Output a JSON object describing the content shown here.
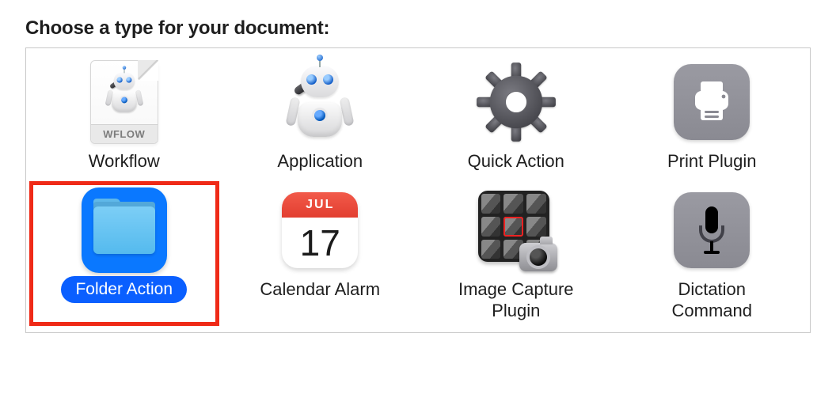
{
  "title": "Choose a type for your document:",
  "selected_type_id": "folder-action",
  "types": {
    "workflow": {
      "label": "Workflow",
      "file_tag": "WFLOW"
    },
    "application": {
      "label": "Application"
    },
    "quick_action": {
      "label": "Quick Action"
    },
    "print_plugin": {
      "label": "Print Plugin"
    },
    "folder_action": {
      "label": "Folder Action"
    },
    "calendar_alarm": {
      "label": "Calendar Alarm",
      "month": "JUL",
      "day": "17"
    },
    "image_capture_plugin": {
      "label": "Image Capture\nPlugin"
    },
    "dictation_command": {
      "label": "Dictation\nCommand"
    }
  }
}
